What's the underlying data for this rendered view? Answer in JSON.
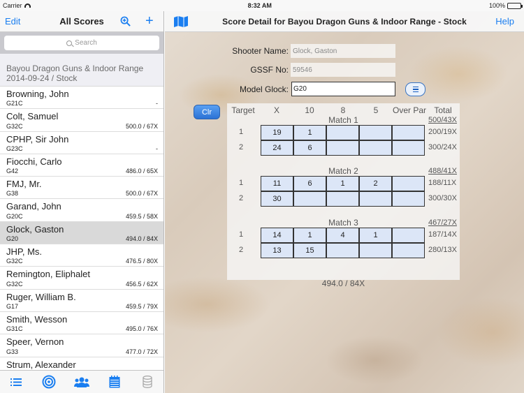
{
  "status": {
    "carrier": "Carrier",
    "time": "8:32 AM",
    "battery": "100%",
    "battery_level": 1.0
  },
  "left": {
    "edit": "Edit",
    "title": "All Scores",
    "search_placeholder": "Search",
    "section_line1": "Bayou Dragon Guns & Indoor Range",
    "section_line2": "2014-09-24 / Stock",
    "shooters": [
      {
        "name": "Browning, John",
        "model": "G21C",
        "score": "-"
      },
      {
        "name": "Colt, Samuel",
        "model": "G32C",
        "score": "500.0 / 67X"
      },
      {
        "name": "CPHP, Sir John",
        "model": "G23C",
        "score": "-"
      },
      {
        "name": "Fiocchi, Carlo",
        "model": "G42",
        "score": "486.0 / 65X"
      },
      {
        "name": "FMJ, Mr.",
        "model": "G38",
        "score": "500.0 / 67X"
      },
      {
        "name": "Garand, John",
        "model": "G20C",
        "score": "459.5 / 58X"
      },
      {
        "name": "Glock, Gaston",
        "model": "G20",
        "score": "494.0 / 84X"
      },
      {
        "name": "JHP, Ms.",
        "model": "G32C",
        "score": "476.5 / 80X"
      },
      {
        "name": "Remington, Eliphalet",
        "model": "G32C",
        "score": "456.5 / 62X"
      },
      {
        "name": "Ruger, William B.",
        "model": "G17",
        "score": "459.5 / 79X"
      },
      {
        "name": "Smith, Wesson",
        "model": "G31C",
        "score": "495.0 / 76X"
      },
      {
        "name": "Speer, Vernon",
        "model": "G33",
        "score": "477.0 / 72X"
      },
      {
        "name": "Strum, Alexander",
        "model": "",
        "score": ""
      }
    ]
  },
  "right": {
    "title": "Score Detail for Bayou Dragon Guns & Indoor Range - Stock",
    "help": "Help",
    "shooter_label": "Shooter Name:",
    "shooter_value": "Glock, Gaston",
    "gssf_label": "GSSF No:",
    "gssf_value": "59546",
    "model_label": "Model Glock:",
    "model_value": "G20",
    "clr": "Clr",
    "headers": [
      "Target",
      "X",
      "10",
      "8",
      "5",
      "Over Par",
      "Total"
    ],
    "matches": [
      {
        "title": "Match 1",
        "total": "500/43X",
        "targets": [
          {
            "num": "1",
            "cells": [
              "19",
              "1",
              "",
              "",
              ""
            ],
            "total": "200/19X"
          },
          {
            "num": "2",
            "cells": [
              "24",
              "6",
              "",
              "",
              ""
            ],
            "total": "300/24X"
          }
        ]
      },
      {
        "title": "Match 2",
        "total": "488/41X",
        "targets": [
          {
            "num": "1",
            "cells": [
              "11",
              "6",
              "1",
              "2",
              ""
            ],
            "total": "188/11X"
          },
          {
            "num": "2",
            "cells": [
              "30",
              "",
              "",
              "",
              ""
            ],
            "total": "300/30X"
          }
        ]
      },
      {
        "title": "Match 3",
        "total": "467/27X",
        "targets": [
          {
            "num": "1",
            "cells": [
              "14",
              "1",
              "4",
              "1",
              ""
            ],
            "total": "187/14X"
          },
          {
            "num": "2",
            "cells": [
              "13",
              "15",
              "",
              "",
              ""
            ],
            "total": "280/13X"
          }
        ]
      }
    ],
    "grand_total": "494.0 / 84X"
  },
  "colors": {
    "accent": "#1a7ef0",
    "cell_fill": "#dce6f7",
    "selected_row": "#d9d9d9"
  }
}
